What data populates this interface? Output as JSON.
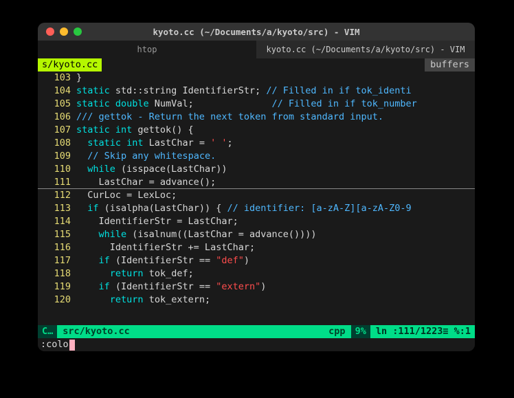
{
  "window": {
    "title": "kyoto.cc (~/Documents/a/kyoto/src) - VIM"
  },
  "tabs": [
    {
      "label": "htop",
      "active": false
    },
    {
      "label": "kyoto.cc (~/Documents/a/kyoto/src) - VIM",
      "active": true
    }
  ],
  "bufferline": {
    "name": "s/kyoto.cc",
    "label": "buffers"
  },
  "code": [
    {
      "n": "103",
      "tokens": [
        [
          "txt",
          "}"
        ]
      ]
    },
    {
      "n": "104",
      "tokens": [
        [
          "kw",
          "static"
        ],
        [
          "txt",
          " std::string IdentifierStr; "
        ],
        [
          "cm",
          "// Filled in if tok_identi"
        ]
      ]
    },
    {
      "n": "105",
      "tokens": [
        [
          "kw",
          "static double"
        ],
        [
          "txt",
          " NumVal;              "
        ],
        [
          "cm",
          "// Filled in if tok_number"
        ]
      ]
    },
    {
      "n": "106",
      "tokens": [
        [
          "cm",
          "/// gettok - Return the next token from standard input."
        ]
      ]
    },
    {
      "n": "107",
      "tokens": [
        [
          "kw",
          "static int"
        ],
        [
          "txt",
          " gettok() {"
        ]
      ]
    },
    {
      "n": "108",
      "tokens": [
        [
          "txt",
          "  "
        ],
        [
          "kw",
          "static int"
        ],
        [
          "txt",
          " LastChar = "
        ],
        [
          "st",
          "' '"
        ],
        [
          "txt",
          ";"
        ]
      ]
    },
    {
      "n": "109",
      "tokens": [
        [
          "txt",
          "  "
        ],
        [
          "cm",
          "// Skip any whitespace."
        ]
      ]
    },
    {
      "n": "110",
      "tokens": [
        [
          "txt",
          "  "
        ],
        [
          "kw",
          "while"
        ],
        [
          "txt",
          " (isspace(LastChar))"
        ]
      ]
    },
    {
      "n": "111",
      "tokens": [
        [
          "txt",
          "    LastChar = advance();"
        ]
      ],
      "underline": true
    },
    {
      "n": "112",
      "tokens": [
        [
          "txt",
          "  CurLoc = LexLoc;"
        ]
      ]
    },
    {
      "n": "113",
      "tokens": [
        [
          "txt",
          "  "
        ],
        [
          "kw",
          "if"
        ],
        [
          "txt",
          " (isalpha(LastChar)) { "
        ],
        [
          "cm",
          "// identifier: [a-zA-Z][a-zA-Z0-9"
        ]
      ]
    },
    {
      "n": "114",
      "tokens": [
        [
          "txt",
          "    IdentifierStr = LastChar;"
        ]
      ]
    },
    {
      "n": "115",
      "tokens": [
        [
          "txt",
          "    "
        ],
        [
          "kw",
          "while"
        ],
        [
          "txt",
          " (isalnum((LastChar = advance())))"
        ]
      ]
    },
    {
      "n": "116",
      "tokens": [
        [
          "txt",
          "      IdentifierStr += LastChar;"
        ]
      ]
    },
    {
      "n": "117",
      "tokens": [
        [
          "txt",
          "    "
        ],
        [
          "kw",
          "if"
        ],
        [
          "txt",
          " (IdentifierStr == "
        ],
        [
          "st",
          "\"def\""
        ],
        [
          "txt",
          ")"
        ]
      ]
    },
    {
      "n": "118",
      "tokens": [
        [
          "txt",
          "      "
        ],
        [
          "kw",
          "return"
        ],
        [
          "txt",
          " tok_def;"
        ]
      ]
    },
    {
      "n": "119",
      "tokens": [
        [
          "txt",
          "    "
        ],
        [
          "kw",
          "if"
        ],
        [
          "txt",
          " (IdentifierStr == "
        ],
        [
          "st",
          "\"extern\""
        ],
        [
          "txt",
          ")"
        ]
      ]
    },
    {
      "n": "120",
      "tokens": [
        [
          "txt",
          "      "
        ],
        [
          "kw",
          "return"
        ],
        [
          "txt",
          " tok_extern;"
        ]
      ]
    }
  ],
  "statusline": {
    "mode": "C…",
    "file": "src/kyoto.cc",
    "filetype": "cpp",
    "percent": "9%",
    "position": "ln :111/1223≡ %:1"
  },
  "cmdline": ":colo"
}
